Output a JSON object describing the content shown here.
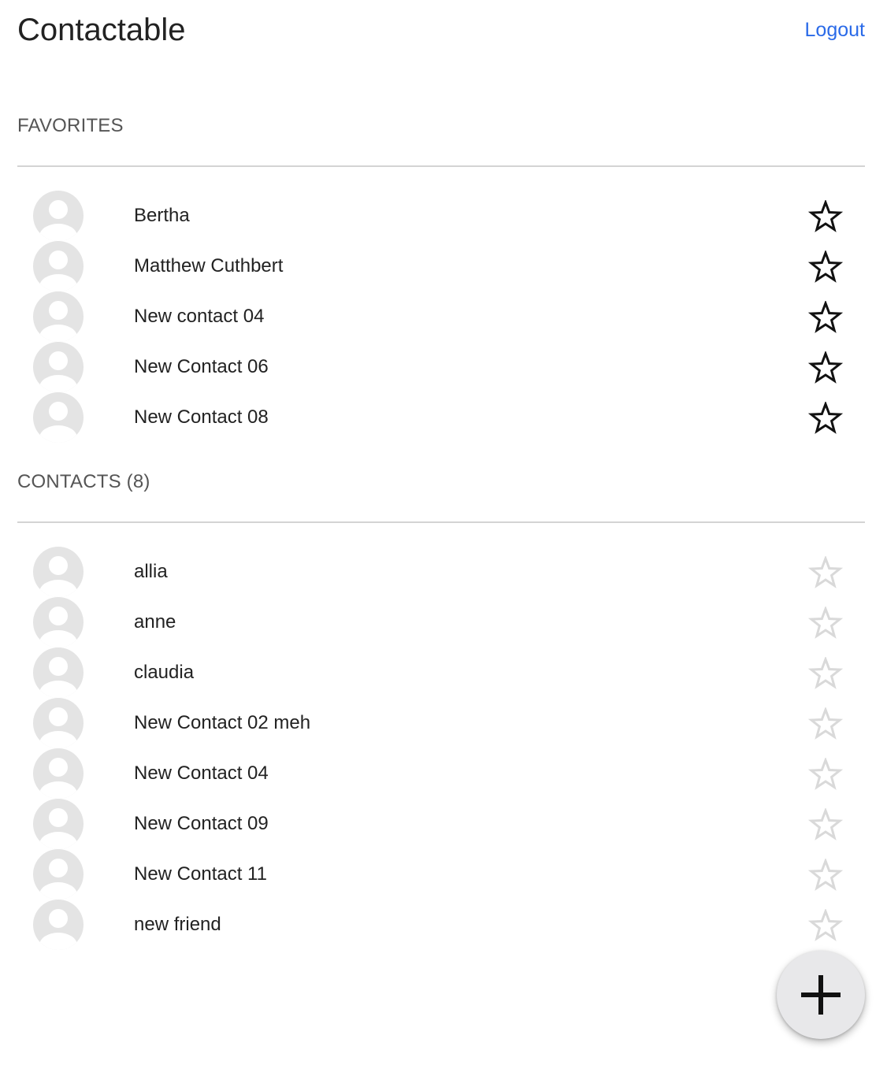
{
  "header": {
    "title": "Contactable",
    "logout_label": "Logout"
  },
  "favorites": {
    "title": "FAVORITES",
    "items": [
      {
        "name": "Bertha",
        "favorite": true
      },
      {
        "name": "Matthew Cuthbert",
        "favorite": true
      },
      {
        "name": "New contact 04",
        "favorite": true
      },
      {
        "name": "New Contact 06",
        "favorite": true
      },
      {
        "name": "New Contact 08",
        "favorite": true
      }
    ]
  },
  "contacts": {
    "title": "CONTACTS (8)",
    "items": [
      {
        "name": "allia",
        "favorite": false
      },
      {
        "name": "anne",
        "favorite": false
      },
      {
        "name": "claudia",
        "favorite": false
      },
      {
        "name": "New Contact 02 meh",
        "favorite": false
      },
      {
        "name": "New Contact 04",
        "favorite": false
      },
      {
        "name": "New Contact 09",
        "favorite": false
      },
      {
        "name": "New Contact 11",
        "favorite": false
      },
      {
        "name": "new friend",
        "favorite": false
      }
    ]
  },
  "icons": {
    "avatar": "avatar-placeholder-icon",
    "favorite": "star-outline-icon",
    "add": "plus-icon"
  },
  "colors": {
    "link": "#2a6ae8",
    "star_favorite": "#111111",
    "star_not_favorite": "#d9d9d9",
    "avatar": "#e4e4e4",
    "fab_background": "#e8e8ea"
  }
}
